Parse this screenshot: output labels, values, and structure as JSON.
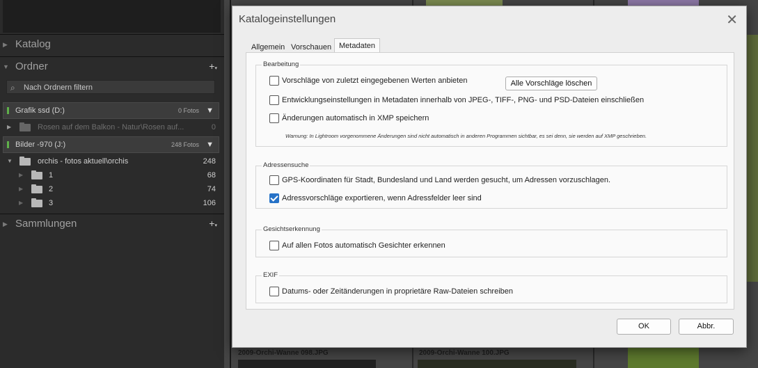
{
  "left_panel": {
    "sections": {
      "katalog": "Katalog",
      "ordner": "Ordner",
      "sammlungen": "Sammlungen"
    },
    "filter_placeholder": "Nach Ordnern filtern",
    "volumes": [
      {
        "name": "Grafik ssd (D:)",
        "count": "0 Fotos"
      },
      {
        "name": "Bilder -970 (J:)",
        "count": "248 Fotos"
      }
    ],
    "folders": [
      {
        "name": "Rosen auf dem Balkon - Natur\\Rosen auf...",
        "count": "0"
      },
      {
        "name": "orchis - fotos aktuell\\orchis",
        "count": "248"
      },
      {
        "name": "1",
        "count": "68"
      },
      {
        "name": "2",
        "count": "74"
      },
      {
        "name": "3",
        "count": "106"
      }
    ]
  },
  "grid": {
    "captions": [
      "2009-Orchi-Wanne 098.JPG",
      "2009-Orchi-Wanne 100.JPG"
    ]
  },
  "dialog": {
    "title": "Katalogeinstellungen",
    "tabs": [
      "Allgemein",
      "Vorschauen",
      "Metadaten"
    ],
    "active_tab": "Metadaten",
    "groups": {
      "bearbeitung": {
        "title": "Bearbeitung",
        "opt_suggest": "Vorschläge von zuletzt eingegebenen Werten anbieten",
        "clear_btn": "Alle Vorschläge löschen",
        "opt_include": "Entwicklungseinstellungen in Metadaten innerhalb von JPEG-, TIFF-, PNG- und PSD-Dateien einschließen",
        "opt_xmp": "Änderungen automatisch in XMP speichern",
        "warning": "Warnung: In Lightroom vorgenommene Änderungen sind nicht automatisch in anderen Programmen sichtbar, es sei denn, sie werden auf XMP geschrieben."
      },
      "adressensuche": {
        "title": "Adressensuche",
        "opt_gps": "GPS-Koordinaten für Stadt, Bundesland und Land werden gesucht, um Adressen vorzuschlagen.",
        "opt_export": "Adressvorschläge exportieren, wenn Adressfelder leer sind"
      },
      "gesicht": {
        "title": "Gesichtserkennung",
        "opt_faces": "Auf allen Fotos automatisch Gesichter erkennen"
      },
      "exif": {
        "title": "EXIF",
        "opt_raw": "Datums- oder Zeitänderungen in proprietäre Raw-Dateien schreiben"
      }
    },
    "checkbox_states": {
      "suggest": false,
      "include": false,
      "xmp": false,
      "gps": false,
      "export": true,
      "faces": false,
      "raw": false
    },
    "buttons": {
      "ok": "OK",
      "cancel": "Abbr."
    },
    "accent_color": "#2672c7"
  }
}
